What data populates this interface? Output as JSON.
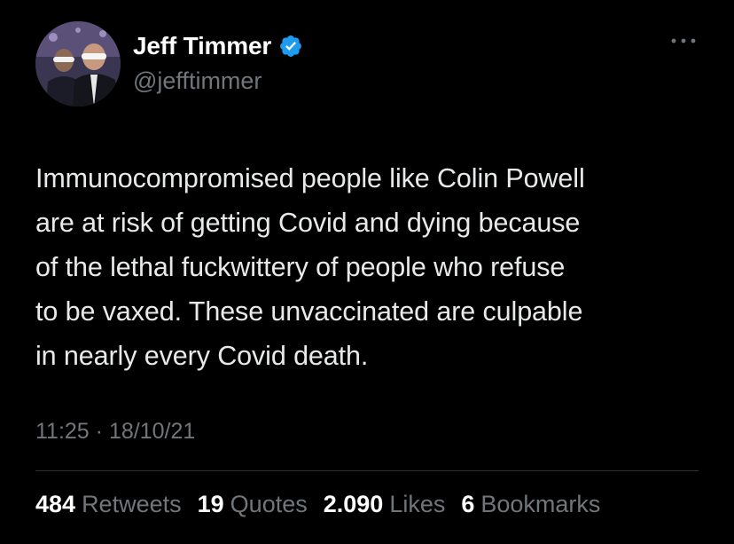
{
  "colors": {
    "background": "#000000",
    "primary_text": "#e7e9ea",
    "name_text": "#ffffff",
    "secondary_text": "#71767b",
    "verified_badge": "#1d9bf0",
    "divider": "#2f3336"
  },
  "author": {
    "display_name": "Jeff Timmer",
    "handle": "@jefftimmer",
    "verified": true,
    "avatar_icon": "user-avatar-photo",
    "badge_icon": "verified-badge-icon"
  },
  "menu_icon": "more-options-icon",
  "tweet": {
    "text": "Immunocompromised people like Colin Powell\nare at risk of getting Covid and dying because\nof the lethal fuckwittery of people who refuse\nto be vaxed. These unvaccinated are culpable\nin nearly every Covid death.",
    "time": "11:25",
    "separator": " · ",
    "date": "18/10/21"
  },
  "stats": [
    {
      "count": "484",
      "label": "Retweets"
    },
    {
      "count": "19",
      "label": "Quotes"
    },
    {
      "count": "2.090",
      "label": "Likes"
    },
    {
      "count": "6",
      "label": "Bookmarks"
    }
  ]
}
